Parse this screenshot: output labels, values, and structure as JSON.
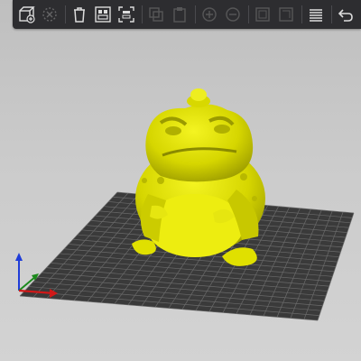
{
  "app": {
    "view": "3D plater"
  },
  "toolbar": {
    "tools": [
      {
        "name": "add-object-button",
        "icon": "add-cube-icon",
        "enabled": true
      },
      {
        "name": "delete-button",
        "icon": "delete-icon",
        "enabled": false
      },
      {
        "name": "delete-all-button",
        "icon": "trash-icon",
        "enabled": true
      },
      {
        "name": "arrange-button",
        "icon": "arrange-icon",
        "enabled": true
      },
      {
        "name": "arrange-selection-button",
        "icon": "arrange-selection-icon",
        "enabled": true
      },
      {
        "name": "copy-button",
        "icon": "copy-icon",
        "enabled": false
      },
      {
        "name": "paste-button",
        "icon": "paste-icon",
        "enabled": false
      },
      {
        "name": "add-instance-button",
        "icon": "add-instance-icon",
        "enabled": false
      },
      {
        "name": "remove-instance-button",
        "icon": "remove-instance-icon",
        "enabled": false
      },
      {
        "name": "split-objects-button",
        "icon": "split-objects-icon",
        "enabled": false
      },
      {
        "name": "split-parts-button",
        "icon": "split-parts-icon",
        "enabled": false
      },
      {
        "name": "layers-editing-button",
        "icon": "layers-icon",
        "enabled": true
      },
      {
        "name": "undo-button",
        "icon": "undo-icon",
        "enabled": true
      }
    ]
  },
  "scene": {
    "model": "toad",
    "model_color": "#e6e600",
    "bed_color": "#3a3a3a",
    "grid_color": "#6e6e6e"
  }
}
